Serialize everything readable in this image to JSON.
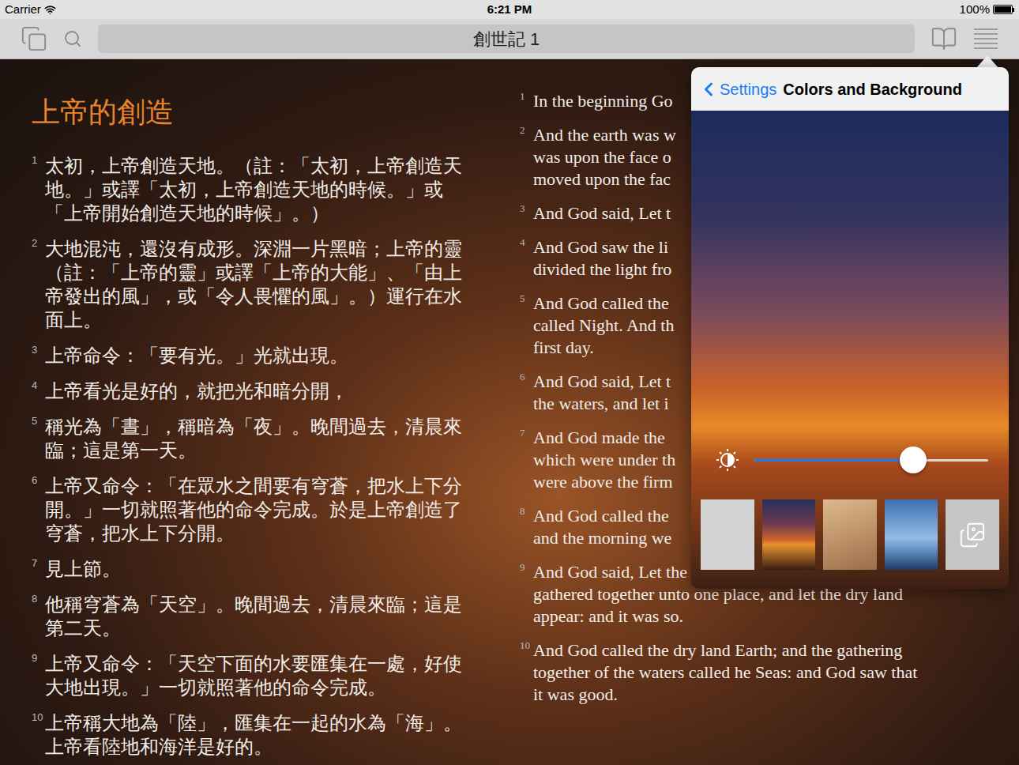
{
  "status_bar": {
    "carrier": "Carrier",
    "time": "6:21 PM",
    "battery": "100%",
    "battery_level": 1
  },
  "toolbar": {
    "title": "創世記 1"
  },
  "chinese": {
    "heading": "上帝的創造",
    "verses": [
      {
        "number": "1",
        "text": "太初，上帝創造天地。（註：「太初，上帝創造天地。」或譯「太初，上帝創造天地的時候。」或「上帝開始創造天地的時候」。）"
      },
      {
        "number": "2",
        "text": "大地混沌，還沒有成形。深淵一片黑暗；上帝的靈（註：「上帝的靈」或譯「上帝的大能」、「由上帝發出的風」，或「令人畏懼的風」。）運行在水面上。"
      },
      {
        "number": "3",
        "text": "上帝命令：「要有光。」光就出現。"
      },
      {
        "number": "4",
        "text": "上帝看光是好的，就把光和暗分開，"
      },
      {
        "number": "5",
        "text": "稱光為「晝」，稱暗為「夜」。晚間過去，清晨來臨；這是第一天。"
      },
      {
        "number": "6",
        "text": "上帝又命令：「在眾水之間要有穹蒼，把水上下分開。」一切就照著他的命令完成。於是上帝創造了穹蒼，把水上下分開。"
      },
      {
        "number": "7",
        "text": "見上節。"
      },
      {
        "number": "8",
        "text": "他稱穹蒼為「天空」。晚間過去，清晨來臨；這是第二天。"
      },
      {
        "number": "9",
        "text": "上帝又命令：「天空下面的水要匯集在一處，好使大地出現。」一切就照著他的命令完成。"
      },
      {
        "number": "10",
        "text": "上帝稱大地為「陸」，匯集在一起的水為「海」。上帝看陸地和海洋是好的。"
      }
    ]
  },
  "english": {
    "verses": [
      {
        "number": "1",
        "lines": [
          "In the beginning Go"
        ]
      },
      {
        "number": "2",
        "lines": [
          "And the earth was w",
          "was upon the face o",
          "moved upon the fac"
        ]
      },
      {
        "number": "3",
        "lines": [
          "And God said, Let t"
        ]
      },
      {
        "number": "4",
        "lines": [
          "And God saw the li",
          "divided the light fro"
        ]
      },
      {
        "number": "5",
        "lines": [
          "And God called the",
          "called Night. And th",
          "first day."
        ]
      },
      {
        "number": "6",
        "lines": [
          "And God said, Let t",
          "the waters, and let i"
        ]
      },
      {
        "number": "7",
        "lines": [
          "And God made the",
          "which were under th",
          "were above the firm"
        ]
      },
      {
        "number": "8",
        "lines": [
          "And God called the",
          "and the morning we"
        ]
      },
      {
        "number": "9",
        "lines": [
          "And God said, Let the waters under the heaven be",
          "gathered together unto one place, and let the dry land",
          "appear: and it was so."
        ]
      },
      {
        "number": "10",
        "lines": [
          "And God called the dry land Earth; and the gathering",
          "together of the waters called he Seas: and God saw that",
          "it was good."
        ]
      }
    ]
  },
  "popover": {
    "back": "Settings",
    "title": "Colors and Background",
    "brightness": {
      "level": 0.68
    },
    "backgrounds": [
      {
        "kind": "plain"
      },
      {
        "kind": "sunset"
      },
      {
        "kind": "sand"
      },
      {
        "kind": "lighthouse"
      },
      {
        "kind": "picker"
      }
    ]
  }
}
